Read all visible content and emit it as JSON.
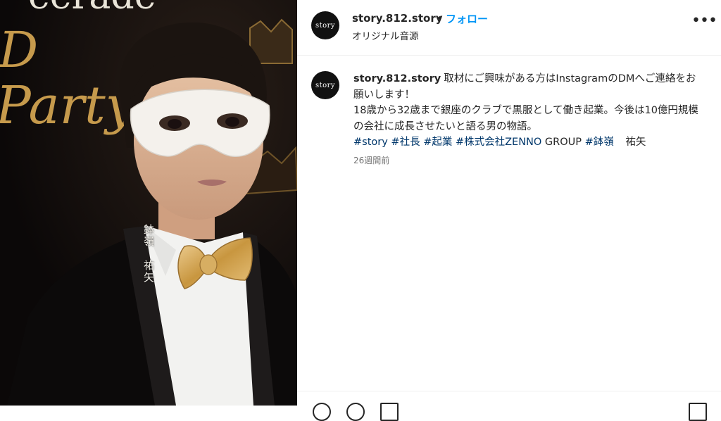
{
  "post": {
    "username": "story.812.story",
    "dot": "•",
    "follow": "フォロー",
    "audio": "オリジナル音源",
    "avatar_text": "story",
    "more": "•••"
  },
  "media": {
    "name_vertical": "鉢嶺　祐矢",
    "bg_title": "eerade",
    "bg_script": "Party"
  },
  "caption": {
    "username": "story.812.story",
    "line1": "取材にご興味がある方はInstagramのDMへご連絡をお願いします！",
    "line2": "18歳から32歳まで銀座のクラブで黒服として働き起業。今後は10億円規模の会社に成長させたいと語る男の物語。",
    "tags": [
      "#story",
      "#社長",
      "#起業",
      "#株式会社ZENNO"
    ],
    "after_tags": "GROUP",
    "tag_last": "#鉢嶺",
    "trailing": "祐矢",
    "timestamp": "26週間前"
  },
  "colors": {
    "follow_blue": "#0095f6",
    "hashtag": "#00376b",
    "gold": "#c8a255"
  }
}
